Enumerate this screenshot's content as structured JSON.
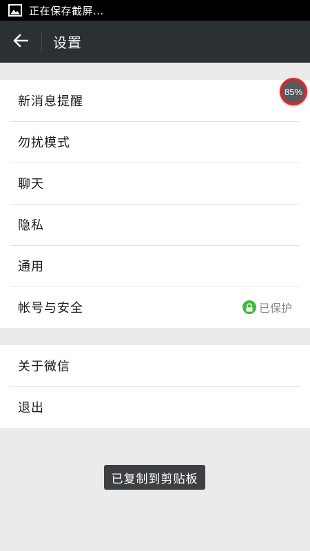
{
  "status_bar": {
    "notification_icon": "image-icon",
    "text": "正在保存截屏..."
  },
  "header": {
    "back_icon": "arrow-left-icon",
    "title": "设置"
  },
  "badge": {
    "percent_text": "85%",
    "value": 85
  },
  "groups": [
    {
      "items": [
        {
          "label": "新消息提醒"
        },
        {
          "label": "勿扰模式"
        },
        {
          "label": "聊天"
        },
        {
          "label": "隐私"
        },
        {
          "label": "通用"
        },
        {
          "label": "帐号与安全",
          "status": "已保护",
          "status_icon": "lock-icon",
          "status_color": "#3dbb3d"
        }
      ]
    },
    {
      "items": [
        {
          "label": "关于微信"
        },
        {
          "label": "退出"
        }
      ]
    }
  ],
  "toast": {
    "text": "已复制到剪贴板"
  },
  "colors": {
    "header_bg": "#2b3033",
    "page_bg": "#ebebeb",
    "badge_ring": "#ce2e2e"
  }
}
